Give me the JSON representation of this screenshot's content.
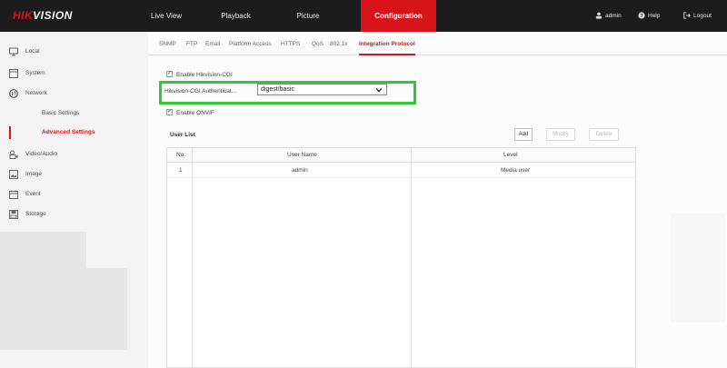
{
  "brand": {
    "part1": "HIK",
    "part2": "VISION"
  },
  "topnav": {
    "items": [
      "Live View",
      "Playback",
      "Picture",
      "Configuration"
    ],
    "active": "Configuration"
  },
  "top_right": {
    "user": "admin",
    "help": "Help",
    "logout": "Logout"
  },
  "sidebar": {
    "items": [
      {
        "label": "Local",
        "icon": "monitor-icon"
      },
      {
        "label": "System",
        "icon": "system-icon"
      },
      {
        "label": "Network",
        "icon": "globe-icon"
      },
      {
        "label": "Video/Audio",
        "icon": "video-audio-icon"
      },
      {
        "label": "Image",
        "icon": "image-icon"
      },
      {
        "label": "Event",
        "icon": "calendar-icon"
      },
      {
        "label": "Storage",
        "icon": "storage-icon"
      }
    ],
    "subitems": [
      "Basic Settings",
      "Advanced Settings"
    ],
    "active_subitem": "Advanced Settings"
  },
  "tabs": [
    "SNMP",
    "FTP",
    "Email",
    "Platform Access",
    "HTTPS",
    "QoS",
    "802.1x",
    "Integration Protocol"
  ],
  "active_tab": "Integration Protocol",
  "form": {
    "enable_cgi_label": "Enable Hikvision-CGI",
    "enable_cgi_checked": true,
    "auth_label": "Hikvision-CGI Authenticat...",
    "auth_value": "digest/basic",
    "enable_onvif_label": "Enable ONVIF",
    "enable_onvif_checked": true
  },
  "user_list": {
    "title": "User List",
    "buttons": {
      "add": "Add",
      "modify": "Modify",
      "delete": "Delete"
    },
    "columns": [
      "No.",
      "User Name",
      "Level"
    ],
    "rows": [
      {
        "no": "1",
        "user": "admin",
        "level": "Media user"
      }
    ]
  },
  "colors": {
    "accent": "#d7141a",
    "highlight": "#34c734",
    "topbar": "#1c1c1c"
  }
}
